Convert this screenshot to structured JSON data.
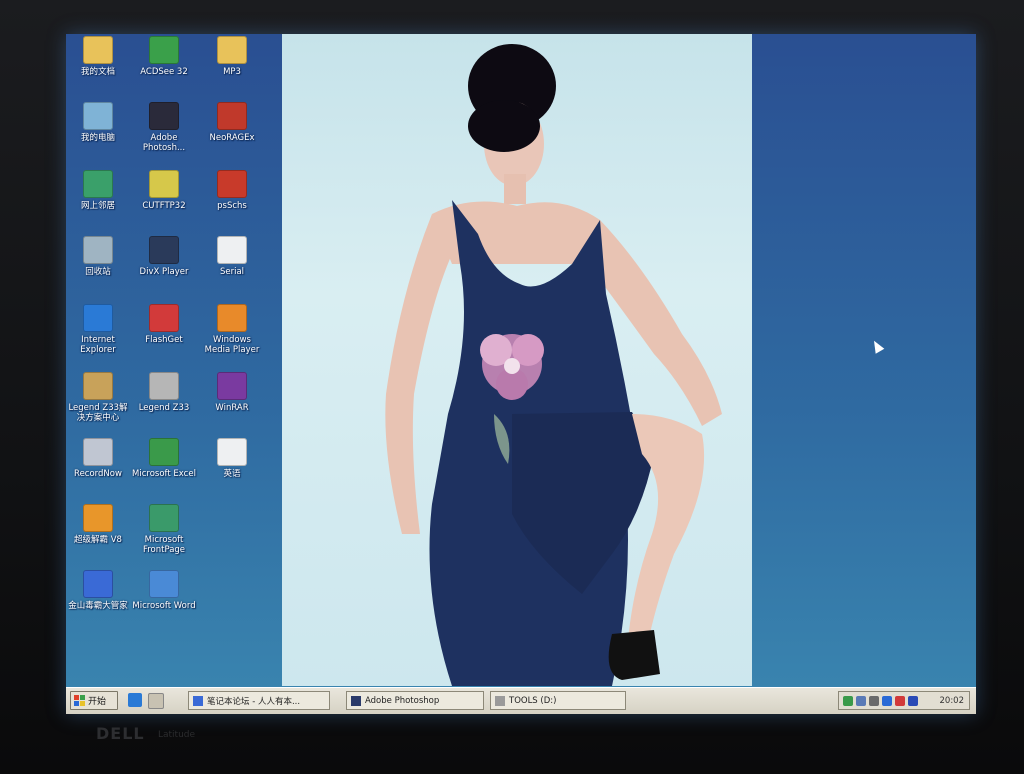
{
  "desktop": {
    "icons": [
      {
        "label": "我的文档",
        "glyph": "my-documents-icon",
        "color": "#e8c25a"
      },
      {
        "label": "ACDSee 32",
        "glyph": "acdsee-icon",
        "color": "#3aa04a"
      },
      {
        "label": "MP3",
        "glyph": "folder-icon",
        "color": "#e8c25a"
      },
      {
        "label": "我的电脑",
        "glyph": "my-computer-icon",
        "color": "#7fb3d6"
      },
      {
        "label": "Adobe Photosh...",
        "glyph": "photoshop-eye-icon",
        "color": "#2a2a3a"
      },
      {
        "label": "NeoRAGEx",
        "glyph": "neoragex-icon",
        "color": "#c0392b"
      },
      {
        "label": "网上邻居",
        "glyph": "network-neighborhood-icon",
        "color": "#3aa06a"
      },
      {
        "label": "CUTFTP32",
        "glyph": "cuteftp-icon",
        "color": "#d6c84a"
      },
      {
        "label": "psSchs",
        "glyph": "game-icon",
        "color": "#c83a2a"
      },
      {
        "label": "回收站",
        "glyph": "recycle-bin-icon",
        "color": "#9fb4c2"
      },
      {
        "label": "DivX Player",
        "glyph": "divx-player-icon",
        "color": "#2a3a5a"
      },
      {
        "label": "Serial",
        "glyph": "text-document-icon",
        "color": "#eef0f2"
      },
      {
        "label": "Internet Explorer",
        "glyph": "internet-explorer-icon",
        "color": "#2a7ad6"
      },
      {
        "label": "FlashGet",
        "glyph": "flashget-icon",
        "color": "#d23a3a"
      },
      {
        "label": "Windows Media Player",
        "glyph": "media-player-icon",
        "color": "#e88a2a"
      },
      {
        "label": "Legend Z33解决方案中心",
        "glyph": "legend-support-icon",
        "color": "#c8a25a"
      },
      {
        "label": "Legend Z33",
        "glyph": "legend-icon",
        "color": "#b6b6b6"
      },
      {
        "label": "WinRAR",
        "glyph": "winrar-icon",
        "color": "#7a3aa0"
      },
      {
        "label": "RecordNow",
        "glyph": "recordnow-icon",
        "color": "#c0c6d2"
      },
      {
        "label": "Microsoft Excel",
        "glyph": "excel-icon",
        "color": "#3a9a4a"
      },
      {
        "label": "英语",
        "glyph": "text-document-icon",
        "color": "#eef0f2"
      },
      {
        "label": "超级解霸 V8",
        "glyph": "player-icon",
        "color": "#e8962a"
      },
      {
        "label": "Microsoft FrontPage",
        "glyph": "frontpage-icon",
        "color": "#3a9a6a"
      },
      {
        "label": "金山毒霸大管家",
        "glyph": "antivirus-icon",
        "color": "#3a6ad6"
      },
      {
        "label": "Microsoft Word",
        "glyph": "word-icon",
        "color": "#4a8ad6"
      }
    ]
  },
  "taskbar": {
    "start_label": "开始",
    "tasks": [
      {
        "label": "笔记本论坛 - 人人有本...",
        "icon": "browser-window-icon",
        "color": "#3a6ad6"
      },
      {
        "label": "Adobe Photoshop",
        "icon": "photoshop-icon",
        "color": "#2a3a6a"
      },
      {
        "label": "TOOLS (D:)",
        "icon": "drive-icon",
        "color": "#9a9a9a"
      }
    ],
    "tray_icons": [
      "network-icon",
      "ime-icon",
      "volume-icon",
      "shield-icon",
      "antivirus-tray-icon",
      "ch-indicator-icon"
    ],
    "clock": "20:02"
  },
  "monitor": {
    "brand": "DELL",
    "model": "Latitude"
  },
  "colors": {
    "desktop_top": "#2a4f92",
    "desktop_bottom": "#3a86b0",
    "dress": "#1e3160",
    "flower": "#c98ab8"
  }
}
